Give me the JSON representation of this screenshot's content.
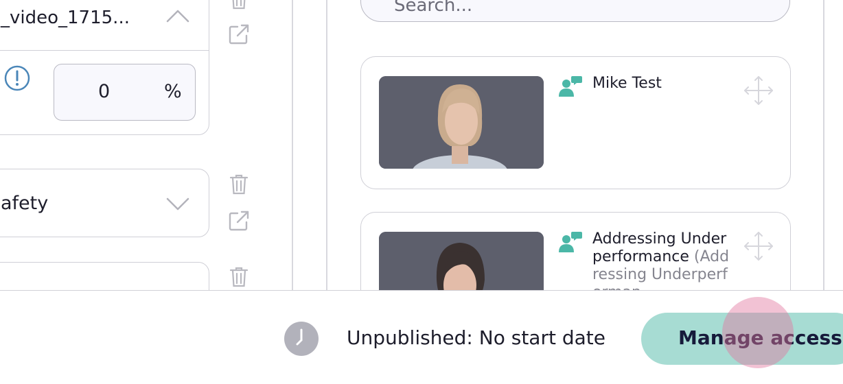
{
  "left_panel": {
    "video_card": {
      "title": "_video_1715...",
      "percent_value": "0",
      "percent_unit": "%"
    },
    "safety_card": {
      "label": "afety"
    }
  },
  "search": {
    "placeholder": "Search..."
  },
  "scenarios": [
    {
      "title": "Mike Test",
      "subtitle": ""
    },
    {
      "title": "Addressing Underperformance",
      "subtitle": " (Addressing Underperforman"
    }
  ],
  "footer": {
    "status": "Unpublished: No start date",
    "manage_button": "Manage access"
  },
  "colors": {
    "accent_teal": "#4bb7a7",
    "button_bg": "#a7dcd3",
    "info_blue": "#4a86b8",
    "icon_gray": "#b8b8bf"
  }
}
